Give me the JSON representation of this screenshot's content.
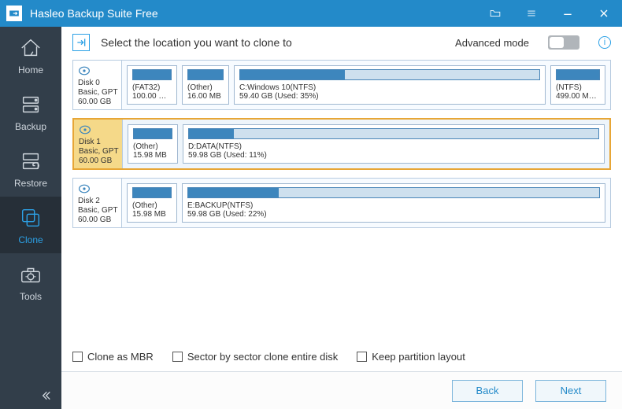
{
  "window": {
    "title": "Hasleo Backup Suite Free"
  },
  "sidebar": {
    "items": [
      {
        "label": "Home"
      },
      {
        "label": "Backup"
      },
      {
        "label": "Restore"
      },
      {
        "label": "Clone"
      },
      {
        "label": "Tools"
      }
    ],
    "active_index": 3
  },
  "instruction": "Select the location you want to clone to",
  "advanced": {
    "label": "Advanced mode",
    "enabled": false
  },
  "disks": [
    {
      "name": "Disk 0",
      "type": "Basic, GPT",
      "size": "60.00 GB",
      "selected": false,
      "partitions": [
        {
          "label": "(FAT32)",
          "size": "100.00 MB ...",
          "fill_pct": 100,
          "flex": "0 0 64px"
        },
        {
          "label": "(Other)",
          "size": "16.00 MB",
          "fill_pct": 100,
          "flex": "0 0 60px"
        },
        {
          "label": "C:Windows 10(NTFS)",
          "size": "59.40 GB (Used: 35%)",
          "fill_pct": 35,
          "flex": "1 1 auto"
        },
        {
          "label": "(NTFS)",
          "size": "499.00 MB ...",
          "fill_pct": 100,
          "flex": "0 0 70px"
        }
      ]
    },
    {
      "name": "Disk 1",
      "type": "Basic, GPT",
      "size": "60.00 GB",
      "selected": true,
      "partitions": [
        {
          "label": "(Other)",
          "size": "15.98 MB",
          "fill_pct": 100,
          "flex": "0 0 64px"
        },
        {
          "label": "D:DATA(NTFS)",
          "size": "59.98 GB (Used: 11%)",
          "fill_pct": 11,
          "flex": "1 1 auto"
        }
      ]
    },
    {
      "name": "Disk 2",
      "type": "Basic, GPT",
      "size": "60.00 GB",
      "selected": false,
      "partitions": [
        {
          "label": "(Other)",
          "size": "15.98 MB",
          "fill_pct": 100,
          "flex": "0 0 64px"
        },
        {
          "label": "E:BACKUP(NTFS)",
          "size": "59.98 GB (Used: 22%)",
          "fill_pct": 22,
          "flex": "1 1 auto"
        }
      ]
    }
  ],
  "options": [
    {
      "label": "Clone as MBR",
      "checked": false
    },
    {
      "label": "Sector by sector clone entire disk",
      "checked": false
    },
    {
      "label": "Keep partition layout",
      "checked": false
    }
  ],
  "footer": {
    "back": "Back",
    "next": "Next"
  }
}
